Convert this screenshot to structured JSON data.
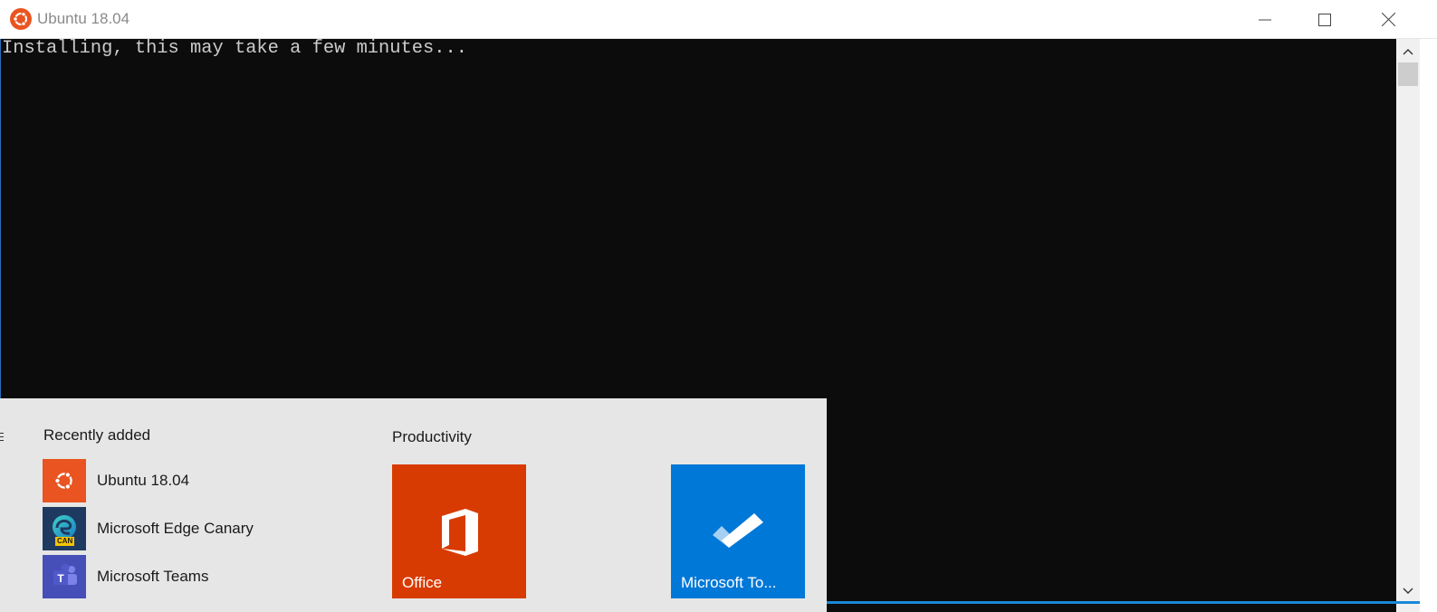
{
  "window": {
    "title": "Ubuntu 18.04",
    "icon": "ubuntu-icon",
    "controls": [
      "minimize-icon",
      "maximize-icon",
      "close-icon"
    ]
  },
  "terminal": {
    "lines": [
      "Installing, this may take a few minutes..."
    ],
    "text_color": "#cccccc",
    "background": "#0c0c0c"
  },
  "start_menu": {
    "recently_added": {
      "heading": "Recently added",
      "apps": [
        {
          "label": "Ubuntu 18.04",
          "icon": "ubuntu-icon",
          "color": "#e95420"
        },
        {
          "label": "Microsoft Edge Canary",
          "icon": "edge-canary-icon",
          "badge": "CAN",
          "color": "#1f3a60"
        },
        {
          "label": "Microsoft Teams",
          "icon": "teams-icon",
          "color": "#464eb8"
        }
      ]
    },
    "productivity": {
      "heading": "Productivity",
      "tiles": [
        {
          "label": "Office",
          "icon": "office-icon",
          "color": "#d83b01"
        },
        {
          "label": "Microsoft To...",
          "icon": "todo-check-icon",
          "color": "#0078d7"
        }
      ]
    }
  }
}
